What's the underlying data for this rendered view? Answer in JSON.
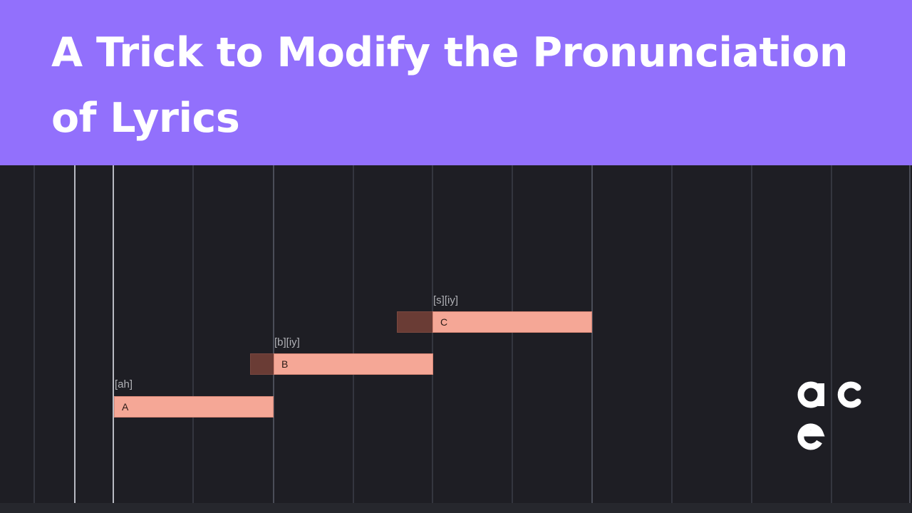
{
  "banner": {
    "title": "A Trick to Modify the Pronunciation of Lyrics"
  },
  "notes": [
    {
      "lyric": "A",
      "phonemes": "[ah]"
    },
    {
      "lyric": "B",
      "phonemes": "[b][iy]"
    },
    {
      "lyric": "C",
      "phonemes": "[s][iy]"
    }
  ],
  "logo": {
    "text": "ace"
  },
  "colors": {
    "banner": "#9270fc",
    "editor_bg": "#1e1e24",
    "note": "#f5a796",
    "note_prefix": "#6a3c35"
  }
}
